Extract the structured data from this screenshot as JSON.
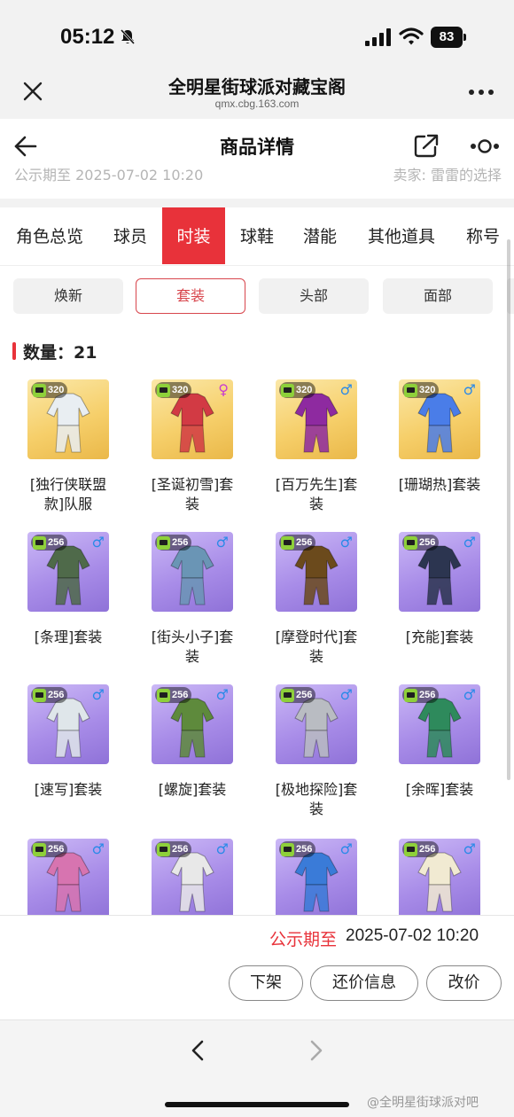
{
  "status_bar": {
    "time": "05:12",
    "battery": "83"
  },
  "browser": {
    "title": "全明星街球派对藏宝阁",
    "url": "qmx.cbg.163.com"
  },
  "header": {
    "title": "商品详情"
  },
  "peek": {
    "left": "公示期至 2025-07-02 10:20",
    "right": "卖家: 雷雷的选择"
  },
  "tabs": [
    {
      "label": "角色总览"
    },
    {
      "label": "球员"
    },
    {
      "label": "时装"
    },
    {
      "label": "球鞋"
    },
    {
      "label": "潜能"
    },
    {
      "label": "其他道具"
    },
    {
      "label": "称号"
    }
  ],
  "active_tab": "时装",
  "subtabs": [
    {
      "label": "焕新"
    },
    {
      "label": "套装"
    },
    {
      "label": "头部"
    },
    {
      "label": "面部"
    }
  ],
  "active_subtab": "套装",
  "count_label": "数量：21",
  "items": [
    {
      "line1": "[独行侠联盟",
      "line2": "款]队服",
      "value": "320",
      "gender": "",
      "bg": "gold",
      "color": "#e9eef2"
    },
    {
      "line1": "[圣诞初雪]套",
      "line2": "装",
      "value": "320",
      "gender": "♀",
      "bg": "gold",
      "color": "#d23a44"
    },
    {
      "line1": "[百万先生]套",
      "line2": "装",
      "value": "320",
      "gender": "♂",
      "bg": "gold",
      "color": "#8e2aa0"
    },
    {
      "line1": "[珊瑚热]套装",
      "line2": "",
      "value": "320",
      "gender": "♂",
      "bg": "gold",
      "color": "#4a7de8"
    },
    {
      "line1": "[条理]套装",
      "line2": "",
      "value": "256",
      "gender": "♂",
      "bg": "purple",
      "color": "#4f6a4a"
    },
    {
      "line1": "[街头小子]套",
      "line2": "装",
      "value": "256",
      "gender": "♂",
      "bg": "purple",
      "color": "#6a95b5"
    },
    {
      "line1": "[摩登时代]套",
      "line2": "装",
      "value": "256",
      "gender": "♂",
      "bg": "purple",
      "color": "#6b4a1c"
    },
    {
      "line1": "[充能]套装",
      "line2": "",
      "value": "256",
      "gender": "♂",
      "bg": "purple",
      "color": "#2c3550"
    },
    {
      "line1": "[速写]套装",
      "line2": "",
      "value": "256",
      "gender": "♂",
      "bg": "purple",
      "color": "#dfe6ea"
    },
    {
      "line1": "[螺旋]套装",
      "line2": "",
      "value": "256",
      "gender": "♂",
      "bg": "purple",
      "color": "#5e8a3c"
    },
    {
      "line1": "[极地探险]套",
      "line2": "装",
      "value": "256",
      "gender": "♂",
      "bg": "purple",
      "color": "#b9bcc2"
    },
    {
      "line1": "[余晖]套装",
      "line2": "",
      "value": "256",
      "gender": "♂",
      "bg": "purple",
      "color": "#2e8a5c"
    },
    {
      "line1": "",
      "line2": "",
      "value": "256",
      "gender": "♂",
      "bg": "purple",
      "color": "#d774b0"
    },
    {
      "line1": "",
      "line2": "",
      "value": "256",
      "gender": "♂",
      "bg": "purple",
      "color": "#e8e8e8"
    },
    {
      "line1": "",
      "line2": "",
      "value": "256",
      "gender": "♂",
      "bg": "purple",
      "color": "#3a7bd8"
    },
    {
      "line1": "",
      "line2": "",
      "value": "256",
      "gender": "♂",
      "bg": "purple",
      "color": "#f1ead2"
    }
  ],
  "footer": {
    "pub_label": "公示期至",
    "pub_date": "2025-07-02 10:20",
    "buttons": [
      {
        "label": "下架"
      },
      {
        "label": "还价信息"
      },
      {
        "label": "改价"
      }
    ]
  },
  "watermark": "@全明星街球派对吧",
  "colors": {
    "accent": "#e8323a",
    "male": "#2a8ae8",
    "female": "#c93bd0"
  }
}
